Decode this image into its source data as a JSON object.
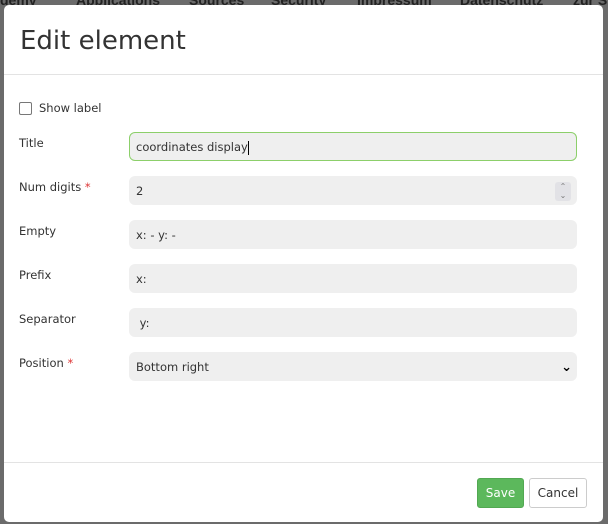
{
  "background_nav": [
    "demy",
    "Applications",
    "Sources",
    "Security",
    "Impressum",
    "Datenschutz",
    "zur S"
  ],
  "modal": {
    "title": "Edit element",
    "show_label": {
      "label": "Show label",
      "checked": false
    },
    "fields": {
      "title": {
        "label": "Title",
        "value": "coordinates display"
      },
      "num_digits": {
        "label": "Num digits",
        "required": "*",
        "value": "2"
      },
      "empty": {
        "label": "Empty",
        "value": "x: - y: -"
      },
      "prefix": {
        "label": "Prefix",
        "value": "x:"
      },
      "separator": {
        "label": "Separator",
        "value": " y:"
      },
      "position": {
        "label": "Position",
        "required": "*",
        "value": "Bottom right"
      }
    },
    "save_label": "Save",
    "cancel_label": "Cancel",
    "colors": {
      "save": "#5cb85c",
      "focus_border": "#8ccf6a",
      "required": "#dd3333"
    }
  }
}
